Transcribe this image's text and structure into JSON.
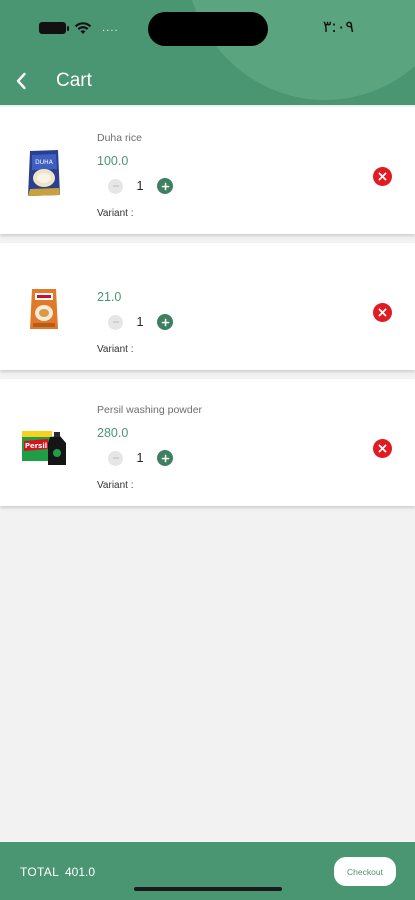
{
  "status_bar": {
    "time": "٣:٠٩",
    "signal_dots": "....",
    "icons": [
      "battery-icon",
      "wifi-icon"
    ]
  },
  "header": {
    "title": "Cart",
    "back_icon": "chevron-left-icon"
  },
  "cart": {
    "items": [
      {
        "name": "Duha rice",
        "price": "100.0",
        "quantity": "1",
        "variant_label": "Variant :",
        "image": "rice-bag-image"
      },
      {
        "name": "",
        "price": "21.0",
        "quantity": "1",
        "variant_label": "Variant :",
        "image": "orange-package-image"
      },
      {
        "name": "Persil washing powder",
        "price": "280.0",
        "quantity": "1",
        "variant_label": "Variant :",
        "image": "persil-detergent-image"
      }
    ]
  },
  "footer": {
    "total_label": "TOTAL",
    "total_value": "401.0",
    "checkout_label": "Checkout"
  },
  "colors": {
    "primary": "#4a9672",
    "plus_button": "#3d7f60",
    "remove_button": "#e11b22",
    "background": "#f2f2f2"
  }
}
